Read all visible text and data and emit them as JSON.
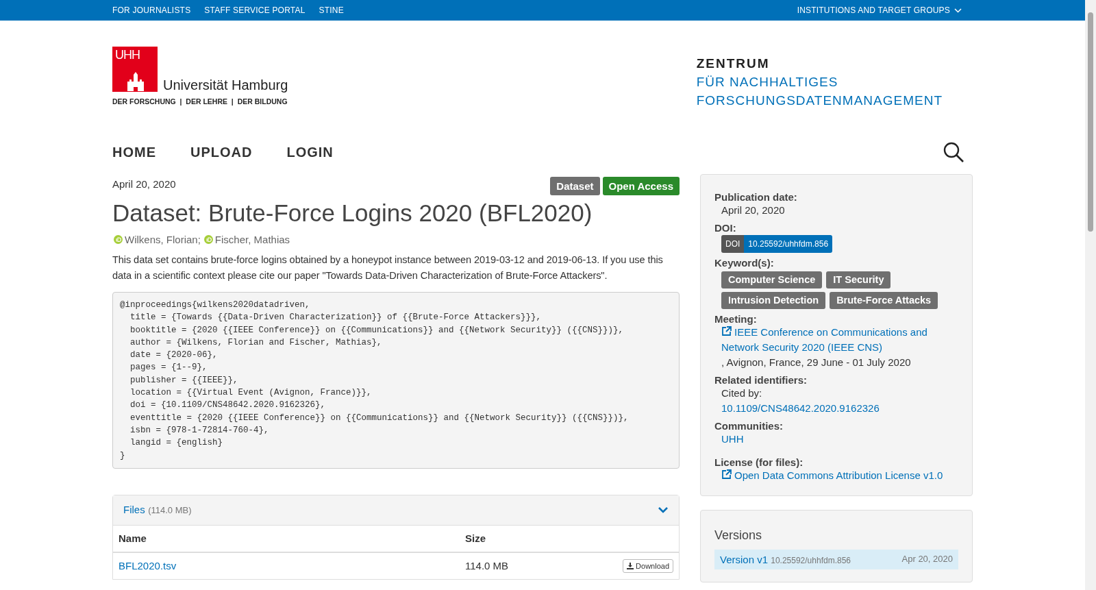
{
  "top_bar": {
    "links": [
      "FOR JOURNALISTS",
      "STAFF SERVICE PORTAL",
      "STINE"
    ],
    "dropdown": "INSTITUTIONS AND TARGET GROUPS"
  },
  "logo": {
    "mark": "UHH",
    "name": "Universität Hamburg",
    "tagline": "DER FORSCHUNG  |  DER LEHRE  |  DER BILDUNG"
  },
  "center": {
    "line_1": "ZENTRUM",
    "line_2": "FÜR NACHHALTIGES",
    "line_3": "FORSCHUNGSDATENMANAGEMENT"
  },
  "nav": [
    "HOME",
    "UPLOAD",
    "LOGIN"
  ],
  "record": {
    "date": "April 20, 2020",
    "badges": [
      {
        "label": "Dataset",
        "color": "#6f6f6f"
      },
      {
        "label": "Open Access",
        "color": "#2a8a2a"
      }
    ],
    "title": "Dataset: Brute-Force Logins 2020 (BFL2020)",
    "authors": [
      "Wilkens, Florian;",
      "Fischer, Mathias"
    ],
    "description": "This data set contains brute-force logins obtained by a honeypot instance between 2019-03-12 and 2019-06-13. If you use this data in a scientific context please cite our paper \"Towards Data-Driven Characterization of Brute-Force Attackers\".",
    "bibtex": [
      "@inproceedings{wilkens2020datadriven,",
      "  title = {Towards {{Data-Driven Characterization}} of {{Brute-Force Attackers}}},",
      "  booktitle = {2020 {{IEEE Conference}} on {{Communications}} and {{Network Security}} ({{CNS}})},",
      "  author = {Wilkens, Florian and Fischer, Mathias},",
      "  date = {2020-06},",
      "  pages = {1--9},",
      "  publisher = {{IEEE}},",
      "  location = {{Virtual Event (Avignon, France)}},",
      "  doi = {10.1109/CNS48642.2020.9162326},",
      "  eventtitle = {2020 {{IEEE Conference}} on {{Communications}} and {{Network Security}} ({{CNS}})},",
      "  isbn = {978-1-72814-760-4},",
      "  langid = {english}",
      "}"
    ]
  },
  "files": {
    "title": "Files",
    "size": "(114.0 MB)",
    "expanded": true,
    "columns": [
      "Name",
      "Size"
    ],
    "rows": [
      {
        "name": "BFL2020.tsv",
        "size": "114.0 MB",
        "action": "Download"
      }
    ]
  },
  "sidebar": {
    "publication_label": "Publication date:",
    "publication_date": "April 20, 2020",
    "doi_label": "DOI:",
    "doi_prefix": "DOI",
    "doi": "10.25592/uhhfdm.856",
    "keywords_label": "Keyword(s):",
    "keywords": [
      "Computer Science",
      "IT Security",
      "Intrusion Detection",
      "Brute-Force Attacks"
    ],
    "meeting_label": "Meeting:",
    "meeting_link": "IEEE Conference on Communications and Network Security 2020 (IEEE CNS)",
    "meeting_place": ", Avignon, France, 29 June - 01 July 2020",
    "related_label": "Related identifiers:",
    "cited_by": "Cited by:",
    "cited_link": "10.1109/CNS48642.2020.9162326",
    "communities_label": "Communities:",
    "community": "UHH",
    "license_label": "License (for files):",
    "license": "Open Data Commons Attribution License v1.0"
  },
  "versions": {
    "title": "Versions",
    "items": [
      {
        "label": "Version v1",
        "doi": "10.25592/uhhfdm.856",
        "date": "Apr 20, 2020",
        "selected": true
      }
    ]
  }
}
